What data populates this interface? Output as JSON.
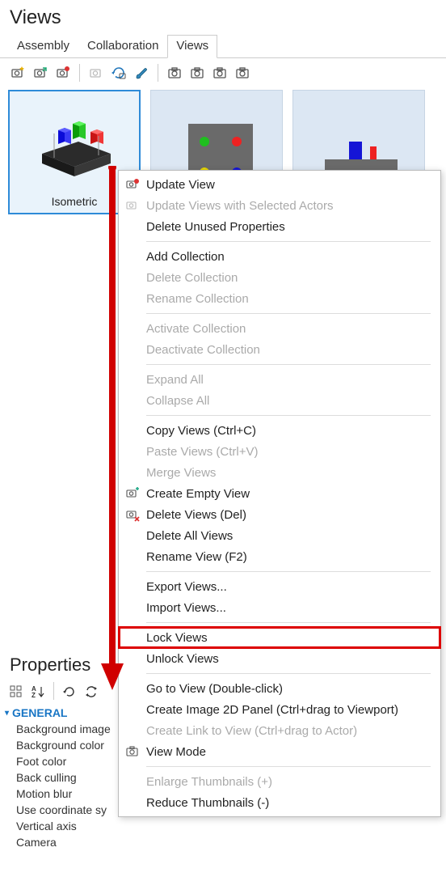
{
  "panel_title": "Views",
  "tabs": [
    {
      "label": "Assembly",
      "active": false
    },
    {
      "label": "Collaboration",
      "active": false
    },
    {
      "label": "Views",
      "active": true
    }
  ],
  "view_tiles": [
    {
      "label": "Isometric",
      "selected": true
    }
  ],
  "context_menu": [
    {
      "label": "Update View",
      "enabled": true,
      "icon": "camera-refresh-icon"
    },
    {
      "label": "Update Views with Selected Actors",
      "enabled": false,
      "icon": "camera-select-icon"
    },
    {
      "label": "Delete Unused Properties",
      "enabled": true
    },
    {
      "sep": true
    },
    {
      "label": "Add Collection",
      "enabled": true
    },
    {
      "label": "Delete Collection",
      "enabled": false
    },
    {
      "label": "Rename Collection",
      "enabled": false
    },
    {
      "sep": true
    },
    {
      "label": "Activate Collection",
      "enabled": false
    },
    {
      "label": "Deactivate Collection",
      "enabled": false
    },
    {
      "sep": true
    },
    {
      "label": "Expand All",
      "enabled": false
    },
    {
      "label": "Collapse All",
      "enabled": false
    },
    {
      "sep": true
    },
    {
      "label": "Copy Views (Ctrl+C)",
      "enabled": true
    },
    {
      "label": "Paste Views (Ctrl+V)",
      "enabled": false
    },
    {
      "label": "Merge Views",
      "enabled": false
    },
    {
      "label": "Create Empty View",
      "enabled": true,
      "icon": "camera-add-icon"
    },
    {
      "label": "Delete Views (Del)",
      "enabled": true,
      "icon": "camera-delete-icon"
    },
    {
      "label": "Delete All Views",
      "enabled": true
    },
    {
      "label": "Rename View (F2)",
      "enabled": true
    },
    {
      "sep": true
    },
    {
      "label": "Export Views...",
      "enabled": true
    },
    {
      "label": "Import Views...",
      "enabled": true
    },
    {
      "sep": true
    },
    {
      "label": "Lock Views",
      "enabled": true,
      "highlight": true
    },
    {
      "label": "Unlock Views",
      "enabled": true
    },
    {
      "sep": true
    },
    {
      "label": "Go to View (Double-click)",
      "enabled": true
    },
    {
      "label": "Create Image 2D Panel (Ctrl+drag to Viewport)",
      "enabled": true
    },
    {
      "label": "Create Link to View (Ctrl+drag to Actor)",
      "enabled": false
    },
    {
      "label": "View Mode",
      "enabled": true,
      "icon": "camera-icon"
    },
    {
      "sep": true
    },
    {
      "label": "Enlarge Thumbnails (+)",
      "enabled": false
    },
    {
      "label": "Reduce Thumbnails (-)",
      "enabled": true
    }
  ],
  "properties": {
    "title": "Properties",
    "section": "GENERAL",
    "rows": [
      "Background image",
      "Background color",
      "Foot color",
      "Back culling",
      "Motion blur",
      "Use coordinate sy",
      "Vertical axis",
      "Camera"
    ]
  },
  "colors": {
    "accent_red": "#d00000",
    "tile_selected": "#2e8bd8"
  }
}
